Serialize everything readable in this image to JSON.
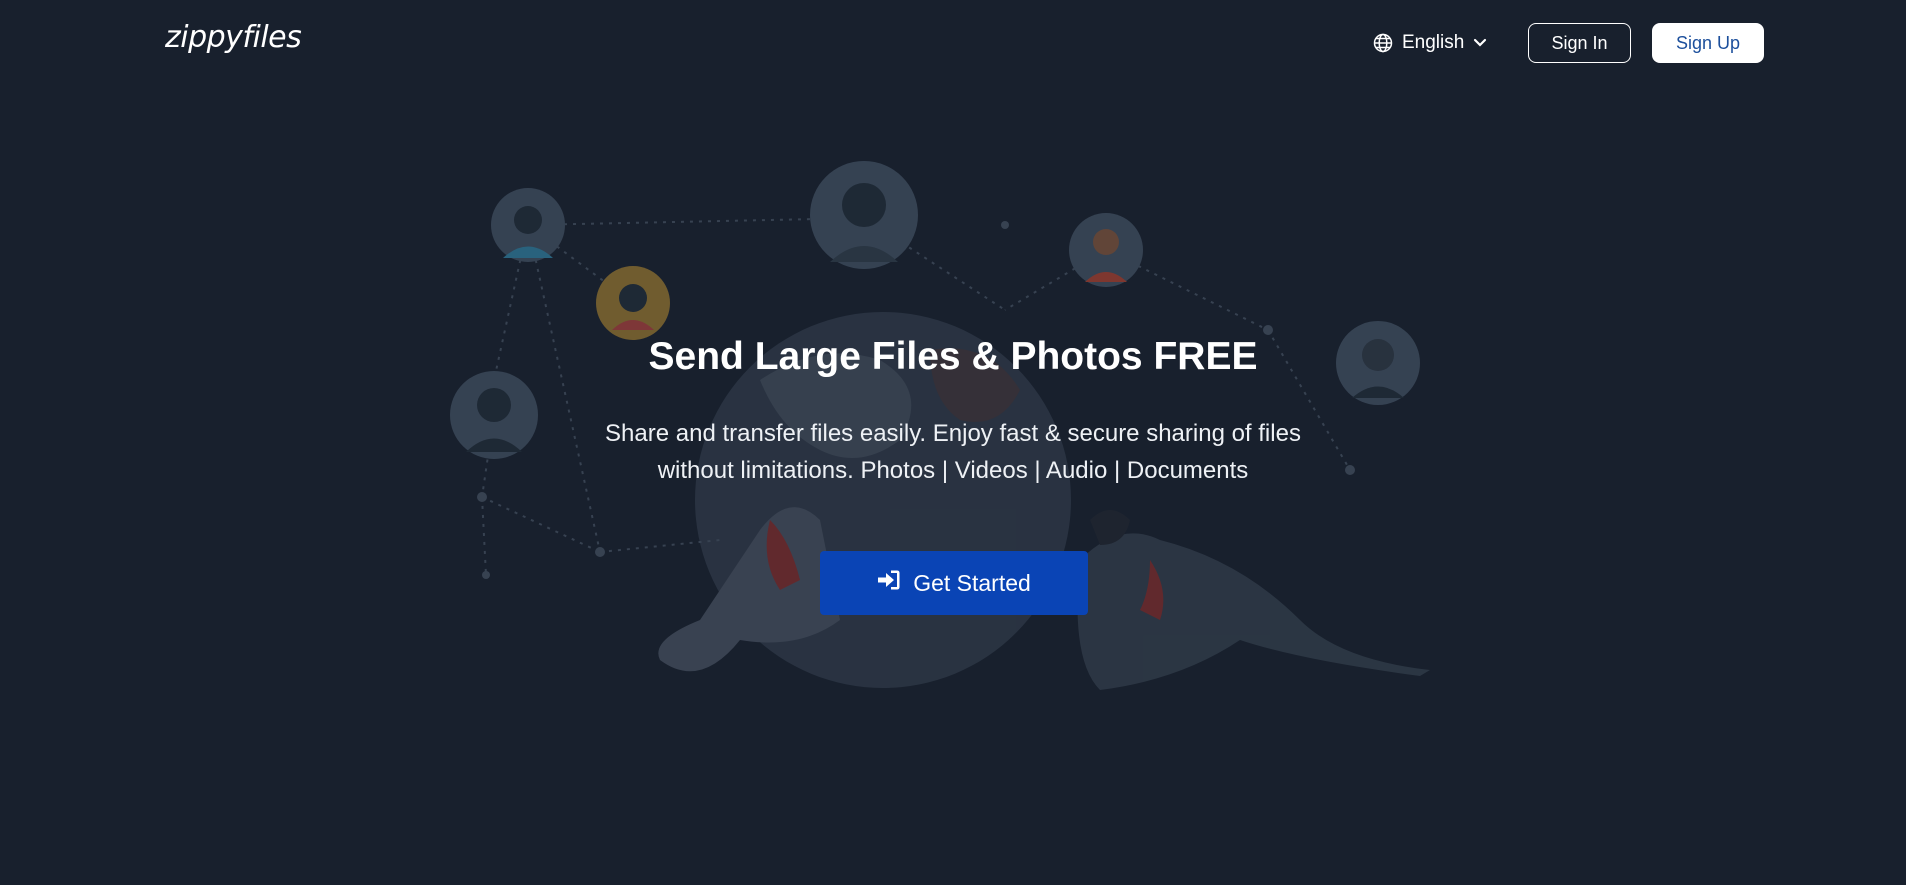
{
  "header": {
    "logo_text": "zippyfiles",
    "language": {
      "label": "English",
      "icon": "globe-icon",
      "caret": "chevron-down-icon"
    },
    "sign_in_label": "Sign In",
    "sign_up_label": "Sign Up"
  },
  "hero": {
    "title": "Send Large Files & Photos FREE",
    "subtitle_line1": "Share and transfer files easily. Enjoy fast & secure sharing of files",
    "subtitle_line2": "without limitations. Photos | Videos | Audio | Documents",
    "cta_label": "Get Started",
    "cta_icon": "sign-in-arrow-icon"
  },
  "colors": {
    "background": "#18202d",
    "cta": "#0a44b5",
    "sign_up_text": "#1c4f9c"
  }
}
